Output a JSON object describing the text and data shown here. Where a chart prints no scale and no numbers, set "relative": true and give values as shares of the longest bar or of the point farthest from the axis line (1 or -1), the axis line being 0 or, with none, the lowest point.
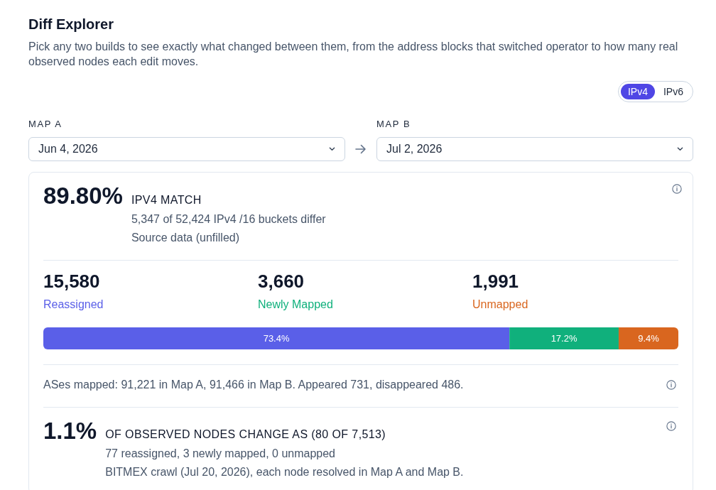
{
  "header": {
    "title": "Diff Explorer",
    "description": "Pick any two builds to see exactly what changed between them, from the address blocks that switched operator to how many real observed nodes each edit moves."
  },
  "protocol_toggle": [
    {
      "label": "IPv4",
      "selected": true
    },
    {
      "label": "IPv6",
      "selected": false
    }
  ],
  "map_a": {
    "label": "MAP A",
    "value": "Jun 4, 2026"
  },
  "map_b": {
    "label": "MAP B",
    "value": "Jul 2, 2026"
  },
  "match_summary": {
    "value": "89.80%",
    "label": "IPV4 MATCH",
    "details": [
      "5,347 of 52,424 IPv4 /16 buckets differ",
      "Source data (unfilled)"
    ]
  },
  "change_stats": [
    {
      "value": "15,580",
      "label": "Reassigned",
      "color": "#5a5fe8"
    },
    {
      "value": "3,660",
      "label": "Newly Mapped",
      "color": "#10b07c"
    },
    {
      "value": "1,991",
      "label": "Unmapped",
      "color": "#d9661f"
    }
  ],
  "change_distribution": {
    "chart_data": {
      "type": "bar",
      "orientation": "horizontal",
      "stacked": true,
      "relative": true,
      "series": [
        {
          "color": "#5a5fe8",
          "values": [
            0.734
          ]
        },
        {
          "color": "#10b07c",
          "values": [
            0.172
          ]
        },
        {
          "color": "#d9661f",
          "values": [
            0.094
          ]
        }
      ],
      "value_labels": [
        "73.4%",
        "17.2%",
        "9.4%"
      ]
    }
  },
  "as_summary": {
    "text": "ASes mapped: 91,221 in Map A, 91,466 in Map B. Appeared 731, disappeared 486."
  },
  "node_change": {
    "value": "1.1%",
    "label": "OF OBSERVED NODES CHANGE AS (80 OF 7,513)",
    "details": [
      "77 reassigned, 3 newly mapped, 0 unmapped",
      "BITMEX crawl (Jul 20, 2026), each node resolved in Map A and Map B."
    ]
  }
}
